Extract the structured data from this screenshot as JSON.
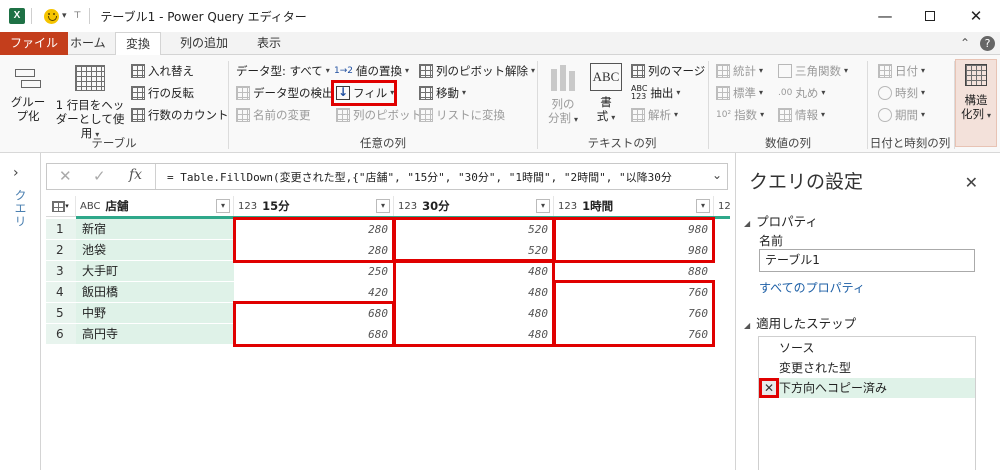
{
  "window": {
    "title": "テーブル1 - Power Query エディター",
    "app_logo": "X",
    "quick_access": [
      "smiley-icon",
      "dropdown-icon",
      "customize-icon"
    ]
  },
  "tabs": [
    {
      "label": "ファイル"
    },
    {
      "label": "ホーム"
    },
    {
      "label": "変換"
    },
    {
      "label": "列の追加"
    },
    {
      "label": "表示"
    }
  ],
  "ribbon": {
    "table": {
      "group_by": "グループ化",
      "group_by_l1": "グルー",
      "group_by_l2": "プ化",
      "first_row_header_l1": "1 行目をヘッ",
      "first_row_header_l2": "ダーとして使用",
      "transpose": "入れ替え",
      "reverse_rows": "行の反転",
      "count_rows": "行数のカウント",
      "label": "テーブル"
    },
    "any_column": {
      "data_type": "データ型: すべて",
      "detect_type": "データ型の検出",
      "rename": "名前の変更",
      "replace_values": "値の置換",
      "fill": "フィル",
      "pivot_column": "列のピボット",
      "unpivot": "列のピボット解除",
      "move": "移動",
      "to_list": "リストに変換",
      "label": "任意の列"
    },
    "text_column": {
      "split_l1": "列の",
      "split_l2": "分割",
      "format_l1": "書",
      "format_l2": "式",
      "merge": "列のマージ",
      "extract": "抽出",
      "parse": "解析",
      "label": "テキストの列"
    },
    "number_column": {
      "statistics": "統計",
      "standard": "標準",
      "scientific": "指数",
      "trig": "三角関数",
      "rounding": "丸め",
      "information": "情報",
      "label": "数値の列"
    },
    "datetime_column": {
      "date": "日付",
      "time": "時刻",
      "duration": "期間",
      "label": "日付と時刻の列"
    },
    "structured": {
      "label_l1": "構造",
      "label_l2": "化列"
    }
  },
  "left_pane": {
    "label": "クエリ"
  },
  "formula_bar": {
    "fx": "fx",
    "formula": "= Table.FillDown(変更された型,{\"店舗\", \"15分\", \"30分\", \"1時間\", \"2時間\", \"以降30分"
  },
  "grid": {
    "columns": [
      {
        "type": "ABC",
        "name": "店舗"
      },
      {
        "type": "123",
        "name": "15分"
      },
      {
        "type": "123",
        "name": "30分"
      },
      {
        "type": "123",
        "name": "1時間"
      },
      {
        "type": "123",
        "name": ""
      }
    ],
    "rows": [
      {
        "n": "1",
        "store": "新宿",
        "m15": "280",
        "m30": "520",
        "h1": "980"
      },
      {
        "n": "2",
        "store": "池袋",
        "m15": "280",
        "m30": "520",
        "h1": "980"
      },
      {
        "n": "3",
        "store": "大手町",
        "m15": "250",
        "m30": "480",
        "h1": "880"
      },
      {
        "n": "4",
        "store": "飯田橋",
        "m15": "420",
        "m30": "480",
        "h1": "760"
      },
      {
        "n": "5",
        "store": "中野",
        "m15": "680",
        "m30": "480",
        "h1": "760"
      },
      {
        "n": "6",
        "store": "高円寺",
        "m15": "680",
        "m30": "480",
        "h1": "760"
      }
    ]
  },
  "query_settings": {
    "title": "クエリの設定",
    "properties_header": "プロパティ",
    "name_label": "名前",
    "name_value": "テーブル1",
    "all_properties": "すべてのプロパティ",
    "applied_steps_header": "適用したステップ",
    "steps": [
      "ソース",
      "変更された型",
      "下方向へコピー済み"
    ]
  },
  "colors": {
    "file_tab": "#c43e1c",
    "accent_green": "#2fa88a",
    "highlight": "#e00000",
    "selected_row": "#dff2e8"
  }
}
